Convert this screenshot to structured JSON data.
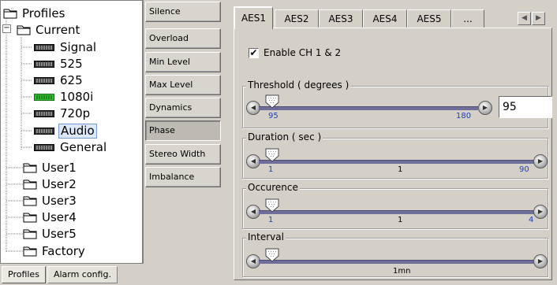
{
  "tree": {
    "root": "Profiles",
    "current": "Current",
    "current_items": [
      {
        "label": "Signal",
        "selected": false,
        "active": false
      },
      {
        "label": "525",
        "selected": false,
        "active": false
      },
      {
        "label": "625",
        "selected": false,
        "active": false
      },
      {
        "label": "1080i",
        "selected": false,
        "active": true
      },
      {
        "label": "720p",
        "selected": false,
        "active": false
      },
      {
        "label": "Audio",
        "selected": true,
        "active": false
      },
      {
        "label": "General",
        "selected": false,
        "active": false
      }
    ],
    "users": [
      "User1",
      "User2",
      "User3",
      "User4",
      "User5",
      "Factory"
    ],
    "expander": "−"
  },
  "bottom_tabs": [
    "Profiles",
    "Alarm config."
  ],
  "categories": [
    {
      "label": "Silence",
      "active": false
    },
    {
      "label": "Overload",
      "active": false
    },
    {
      "label": "Min Level",
      "active": false
    },
    {
      "label": "Max Level",
      "active": false
    },
    {
      "label": "Dynamics",
      "active": false
    },
    {
      "label": "Phase",
      "active": true
    },
    {
      "label": "Stereo Width",
      "active": false
    },
    {
      "label": "Imbalance",
      "active": false
    }
  ],
  "aes_tabs": [
    "AES1",
    "AES2",
    "AES3",
    "AES4",
    "AES5",
    "..."
  ],
  "active_aes_tab": "AES1",
  "enable": {
    "label": "Enable CH 1 & 2",
    "checked": true,
    "mark": "✔"
  },
  "threshold": {
    "title": "Threshold ( degrees )",
    "min": "95",
    "max": "180",
    "value": "95",
    "fraction": 0.0
  },
  "duration": {
    "title": "Duration ( sec )",
    "min": "1",
    "mid": "1",
    "max": "90",
    "fraction": 0.0
  },
  "occurence": {
    "title": "Occurence",
    "min": "1",
    "mid": "1",
    "max": "4",
    "fraction": 0.0
  },
  "interval": {
    "title": "Interval",
    "mid": "1mn",
    "fraction": 0.0
  },
  "icons": {
    "scroll_left": "◀",
    "scroll_right": "▶",
    "step_left": "◀",
    "step_right": "▶"
  },
  "colors": {
    "active_led": "#2fbf2f",
    "inactive_led": "#333333",
    "track": "#6e6e98",
    "tick_label": "#1c3fc4"
  }
}
